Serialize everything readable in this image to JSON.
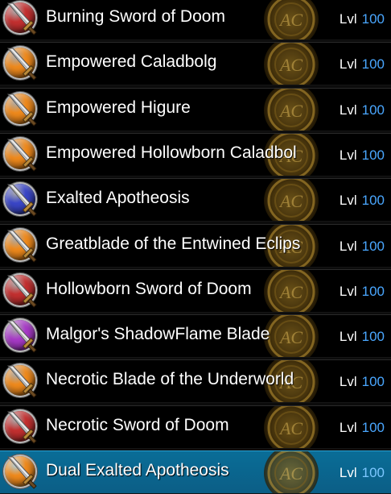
{
  "items": [
    {
      "name": "Burning Sword of Doom",
      "level_label": "Lvl",
      "level": "100",
      "orb_color": "#c43030",
      "icon": "sword-icon",
      "selected": false
    },
    {
      "name": "Empowered Caladbolg",
      "level_label": "Lvl",
      "level": "100",
      "orb_color": "#f08a1c",
      "icon": "sword-icon",
      "selected": false
    },
    {
      "name": "Empowered Higure",
      "level_label": "Lvl",
      "level": "100",
      "orb_color": "#f08a1c",
      "icon": "sword-icon",
      "selected": false
    },
    {
      "name": "Empowered Hollowborn Caladbol",
      "level_label": "Lvl",
      "level": "100",
      "orb_color": "#f08a1c",
      "icon": "sword-icon",
      "selected": false
    },
    {
      "name": "Exalted Apotheosis",
      "level_label": "Lvl",
      "level": "100",
      "orb_color": "#3a46c8",
      "icon": "sword-icon",
      "selected": false
    },
    {
      "name": "Greatblade of the Entwined Eclips",
      "level_label": "Lvl",
      "level": "100",
      "orb_color": "#f08a1c",
      "icon": "sword-icon",
      "selected": false
    },
    {
      "name": "Hollowborn Sword of Doom",
      "level_label": "Lvl",
      "level": "100",
      "orb_color": "#c43030",
      "icon": "sword-icon",
      "selected": false
    },
    {
      "name": "Malgor's ShadowFlame Blade",
      "level_label": "Lvl",
      "level": "100",
      "orb_color": "#a83ac8",
      "icon": "sword-icon",
      "selected": false
    },
    {
      "name": "Necrotic Blade of the Underworld",
      "level_label": "Lvl",
      "level": "100",
      "orb_color": "#f08a1c",
      "icon": "sword-icon",
      "selected": false
    },
    {
      "name": "Necrotic Sword of Doom",
      "level_label": "Lvl",
      "level": "100",
      "orb_color": "#c43030",
      "icon": "sword-icon",
      "selected": false
    },
    {
      "name": "Dual Exalted Apotheosis",
      "level_label": "Lvl",
      "level": "100",
      "orb_color": "#f08a1c",
      "icon": "sword-icon",
      "selected": true
    }
  ],
  "badge": {
    "text": "AC",
    "icon": "ac-emblem-icon"
  }
}
